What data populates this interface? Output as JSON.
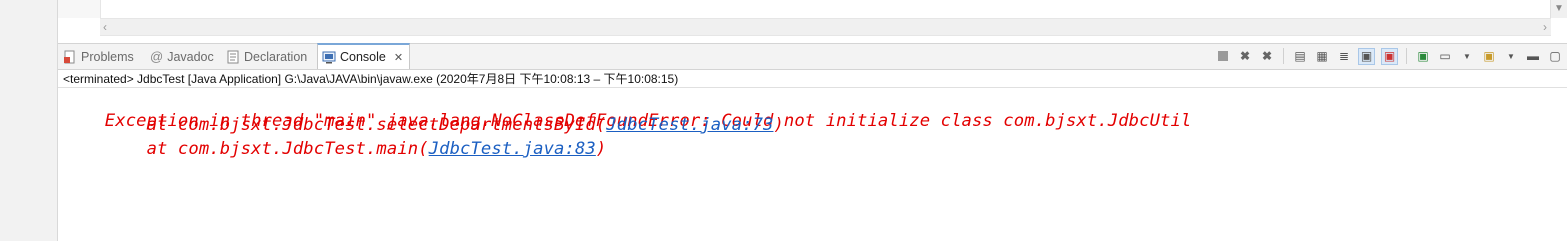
{
  "tabs": [
    {
      "label": "Problems",
      "icon": "problems-icon"
    },
    {
      "label": "Javadoc",
      "icon": "javadoc-icon"
    },
    {
      "label": "Declaration",
      "icon": "declaration-icon"
    },
    {
      "label": "Console",
      "icon": "console-icon",
      "active": true
    }
  ],
  "console": {
    "status": "<terminated> JdbcTest [Java Application] G:\\Java\\JAVA\\bin\\javaw.exe  (2020年7月8日 下午10:08:13 – 下午10:08:15)",
    "line1": "Exception in thread \"main\" java.lang.NoClassDefFoundError: Could not initialize class com.bjsxt.JdbcUtil",
    "line2_prefix": "        at com.bjsxt.JdbcTest.selectDepartmentsById(",
    "line2_link": "JdbcTest.java:73",
    "line2_suffix": ")",
    "line3_prefix": "        at com.bjsxt.JdbcTest.main(",
    "line3_link": "JdbcTest.java:83",
    "line3_suffix": ")"
  },
  "colors": {
    "error_text": "#e30000",
    "link": "#1b5fc2"
  }
}
